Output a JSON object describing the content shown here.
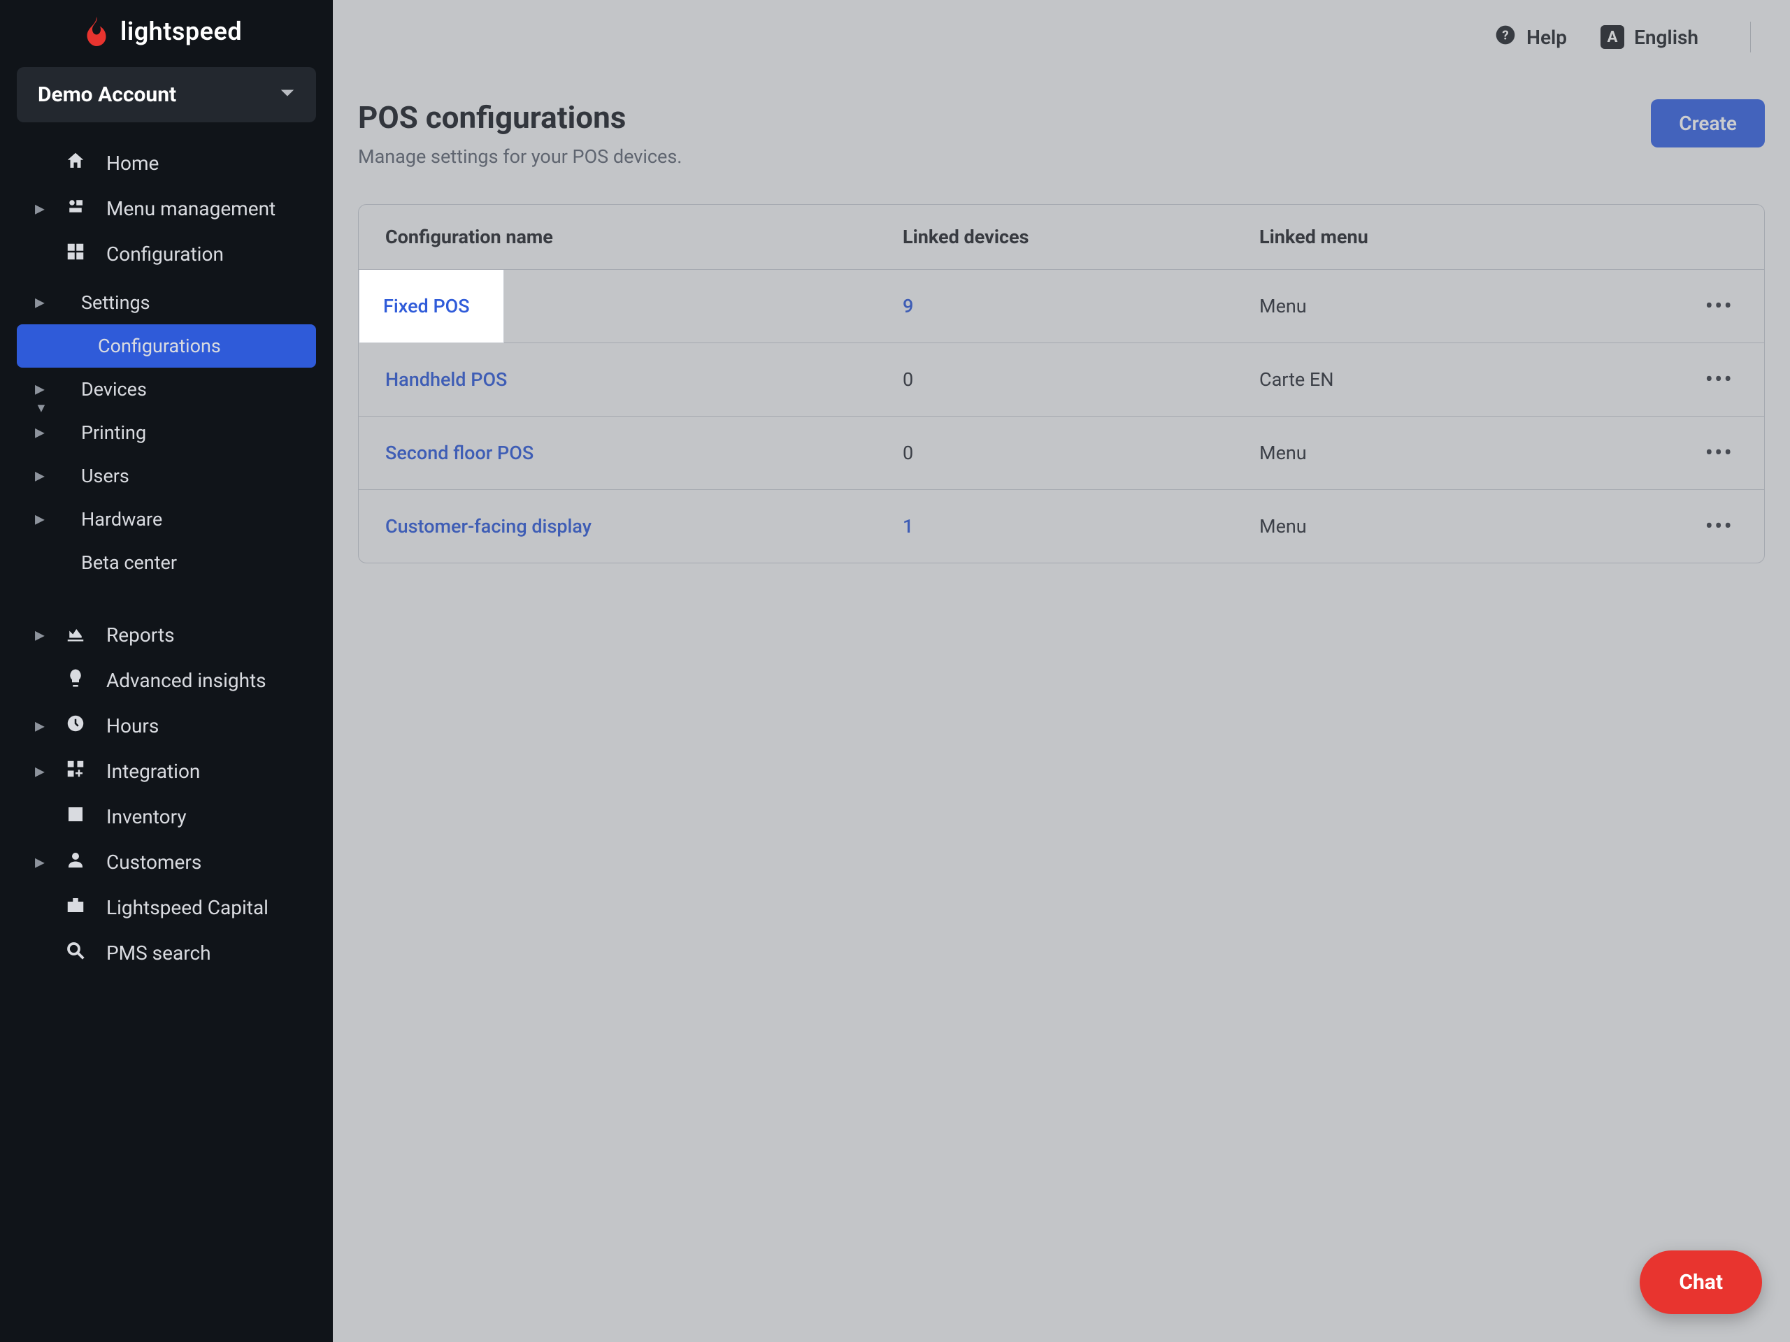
{
  "brand": {
    "name": "lightspeed"
  },
  "account": {
    "label": "Demo Account"
  },
  "sidebar": {
    "home": "Home",
    "menu_mgmt": "Menu management",
    "configuration": "Configuration",
    "config_children": {
      "settings": "Settings",
      "configurations": "Configurations",
      "devices": "Devices",
      "printing": "Printing",
      "users": "Users",
      "hardware": "Hardware",
      "beta_center": "Beta center"
    },
    "reports": "Reports",
    "advanced_insights": "Advanced insights",
    "hours": "Hours",
    "integration": "Integration",
    "inventory": "Inventory",
    "customers": "Customers",
    "lightspeed_capital": "Lightspeed Capital",
    "pms_search": "PMS search"
  },
  "topbar": {
    "help": "Help",
    "lang_badge": "A",
    "lang_label": "English"
  },
  "page": {
    "title": "POS configurations",
    "subtitle": "Manage settings for your POS devices.",
    "create": "Create"
  },
  "table": {
    "headers": {
      "name": "Configuration name",
      "devices": "Linked devices",
      "menu": "Linked menu"
    },
    "rows": [
      {
        "name": "Fixed POS",
        "devices": "9",
        "devices_is_link": true,
        "menu": "Menu"
      },
      {
        "name": "Handheld POS",
        "devices": "0",
        "devices_is_link": false,
        "menu": "Carte EN"
      },
      {
        "name": "Second floor POS",
        "devices": "0",
        "devices_is_link": false,
        "menu": "Menu"
      },
      {
        "name": "Customer-facing display",
        "devices": "1",
        "devices_is_link": true,
        "menu": "Menu"
      }
    ]
  },
  "chat": {
    "label": "Chat"
  },
  "highlight": {
    "text": "Fixed POS"
  }
}
